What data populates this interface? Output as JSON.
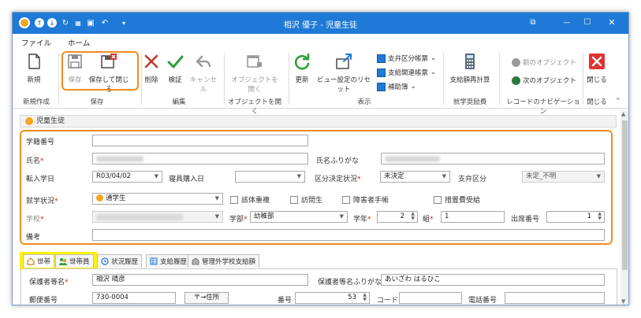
{
  "window": {
    "title": "相沢 優子 - 児童生徒",
    "controls": {
      "restore": "⧉",
      "minimize": "—",
      "maximize": "☐",
      "close": "✕"
    }
  },
  "quick_access": {
    "back_arrow": "↶",
    "dropdown": "▾"
  },
  "menu": {
    "tabs": [
      "ファイル",
      "ホーム"
    ]
  },
  "ribbon": {
    "new": "新規",
    "save": "保存",
    "save_close": "保存して閉じる",
    "delete": "削除",
    "verify": "検証",
    "cancel": "キャンセル",
    "open_object": "オブジェクトを開く",
    "refresh": "更新",
    "reset_view": "ビュー設定のリセット",
    "report1": "支弁区分帳票",
    "report2": "支給関連帳票",
    "report3": "補助簿",
    "recalc": "支給額再計算",
    "prev_object": "前のオブジェクト",
    "next_object": "次のオブジェクト",
    "close": "閉じる",
    "groups": {
      "create": "新規作成",
      "save": "保存",
      "edit": "編集",
      "open": "オブジェクトを開く",
      "display": "表示",
      "aid": "就学奨励費",
      "nav": "レコードのナビゲーション",
      "close": "閉じる"
    },
    "colors": {
      "accent": "#1e7ad6",
      "highlight": "#f08c1a",
      "marker": "#fff200",
      "delete": "#c0392b",
      "check": "#2e9e3b"
    }
  },
  "doc": {
    "header": "児童生徒"
  },
  "form": {
    "student_no_label": "学籍番号",
    "name_label": "氏名",
    "kana_label": "氏名ふりがな",
    "transfer_date_label": "転入学日",
    "transfer_date": "R03/04/02",
    "purchase_date_label": "寝具購入日",
    "category_status_label": "区分決定状況",
    "category_status": "未決定",
    "payer_label": "支弁区分",
    "payer": "未定_不明",
    "attendance_label": "就学状況",
    "attendance": "通学生",
    "check_duplicate": "該体重複",
    "check_visit": "訪問生",
    "check_disability": "障害者手帳",
    "check_measures": "措置費受給",
    "school_label": "学校",
    "dept_label": "学部",
    "dept": "幼稚部",
    "grade_label": "学年",
    "grade": "2",
    "class_label": "組",
    "class": "1",
    "seat_label": "出席番号",
    "seat": "1",
    "notes_label": "備考"
  },
  "tabs": [
    "世帯",
    "世帯員",
    "状況履歴",
    "支給履歴",
    "管理外学校支給額"
  ],
  "household": {
    "guardian_label": "保護者等名",
    "guardian": "相沢 晴彦",
    "guardian_kana_label": "保護者等名ふりがな",
    "guardian_kana": "あいざわ はるひこ",
    "zip_label": "郵便番号",
    "zip": "730-0004",
    "zip_to_addr": "〒→住所",
    "house_no_label": "番号",
    "house_no": "53",
    "code_label": "コード",
    "phone_label": "電話番号"
  }
}
